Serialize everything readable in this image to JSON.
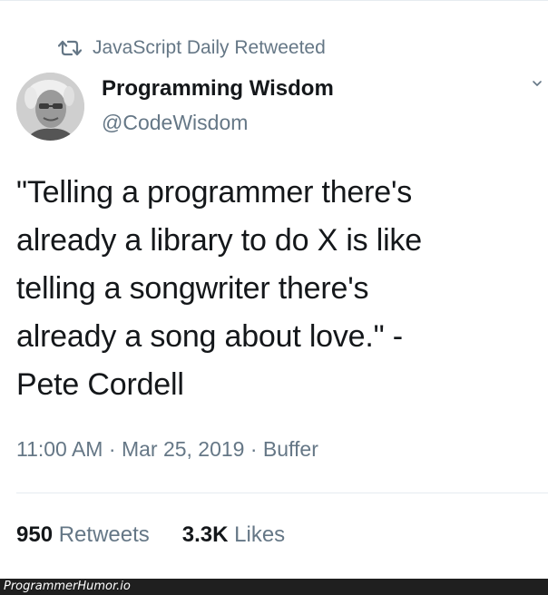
{
  "retweet": {
    "label": "JavaScript Daily Retweeted"
  },
  "author": {
    "display_name": "Programming Wisdom",
    "handle": "@CodeWisdom"
  },
  "tweet": {
    "lines": [
      "\"Telling a programmer there's",
      "already a library to do X is like",
      "telling a songwriter there's",
      "already a song about love.\" -",
      "Pete Cordell"
    ]
  },
  "meta": {
    "time": "11:00 AM",
    "separator": " · ",
    "date": "Mar 25, 2019",
    "via": "Buffer"
  },
  "stats": {
    "retweets_count": "950",
    "retweets_label": "Retweets",
    "likes_count": "3.3K",
    "likes_label": "Likes"
  },
  "watermark": {
    "text": "ProgrammerHumor.io"
  },
  "colors": {
    "text": "#14171a",
    "secondary": "#657786",
    "divider": "#e6ecf0"
  },
  "icons": {
    "retweet": "retweet-icon",
    "caret": "chevron-down-icon",
    "avatar": "avatar"
  }
}
